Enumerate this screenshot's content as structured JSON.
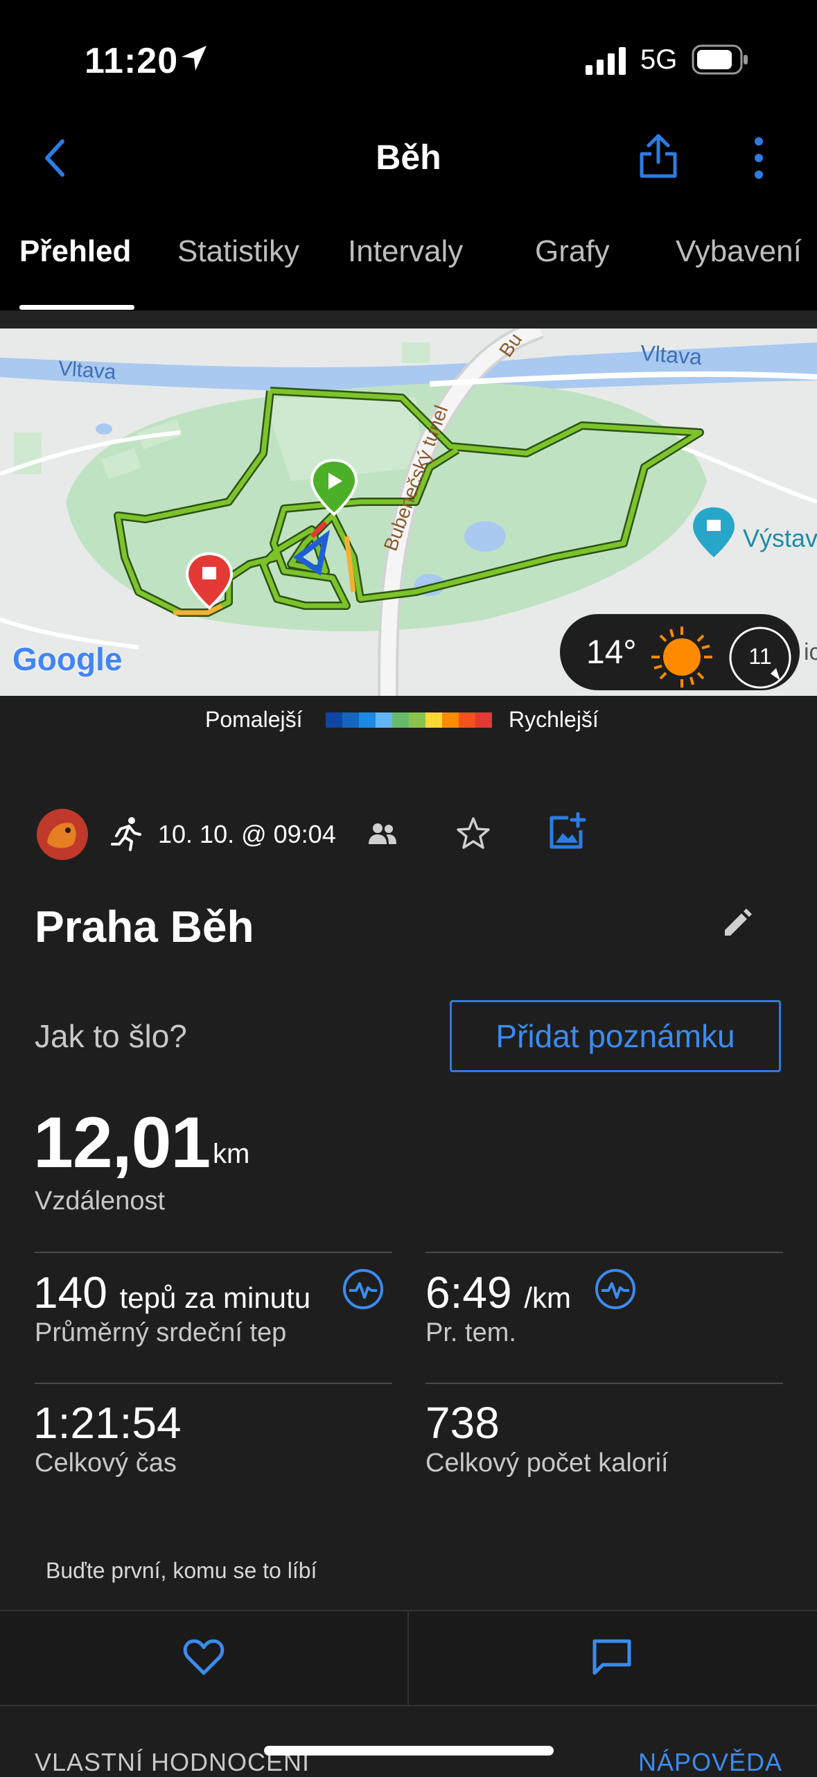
{
  "status_bar": {
    "time": "11:20",
    "network": "5G"
  },
  "header": {
    "title": "Běh"
  },
  "tabs": [
    {
      "label": "Přehled"
    },
    {
      "label": "Statistiky"
    },
    {
      "label": "Intervaly"
    },
    {
      "label": "Grafy"
    },
    {
      "label": "Vybavení"
    }
  ],
  "map": {
    "labels": {
      "river_left": "Vltava",
      "river_right": "Vltava",
      "tunnel": "Bubenečský tunel",
      "road": "Bu",
      "poi": "Výstav",
      "edge": "ic",
      "google": "Google"
    },
    "weather": {
      "temperature": "14°",
      "wind": "11"
    }
  },
  "legend": {
    "slower": "Pomalejší",
    "faster": "Rychlejší",
    "colors": [
      "#0d47a1",
      "#1565c0",
      "#1e88e5",
      "#64b5f6",
      "#66bb6a",
      "#8bc34a",
      "#fdd835",
      "#fb8c00",
      "#f4511e",
      "#e53935"
    ]
  },
  "activity": {
    "datetime": "10. 10. @ 09:04",
    "name": "Praha Běh",
    "question": "Jak to šlo?",
    "add_note": "Přidat poznámku"
  },
  "stats": {
    "distance": {
      "value": "12,01",
      "unit": "km",
      "label": "Vzdálenost"
    },
    "heart_rate": {
      "value": "140",
      "unit": "tepů za minutu",
      "label": "Průměrný srdeční tep"
    },
    "pace": {
      "value": "6:49",
      "unit": "/km",
      "label": "Pr. tem."
    },
    "time": {
      "value": "1:21:54",
      "label": "Celkový čas"
    },
    "calories": {
      "value": "738",
      "label": "Celkový počet kalorií"
    }
  },
  "social": {
    "like_prompt": "Buďte první, komu se to líbí"
  },
  "footer": {
    "self_rating": "VLASTNÍ HODNOCENÍ",
    "help": "NÁPOVĚDA"
  }
}
